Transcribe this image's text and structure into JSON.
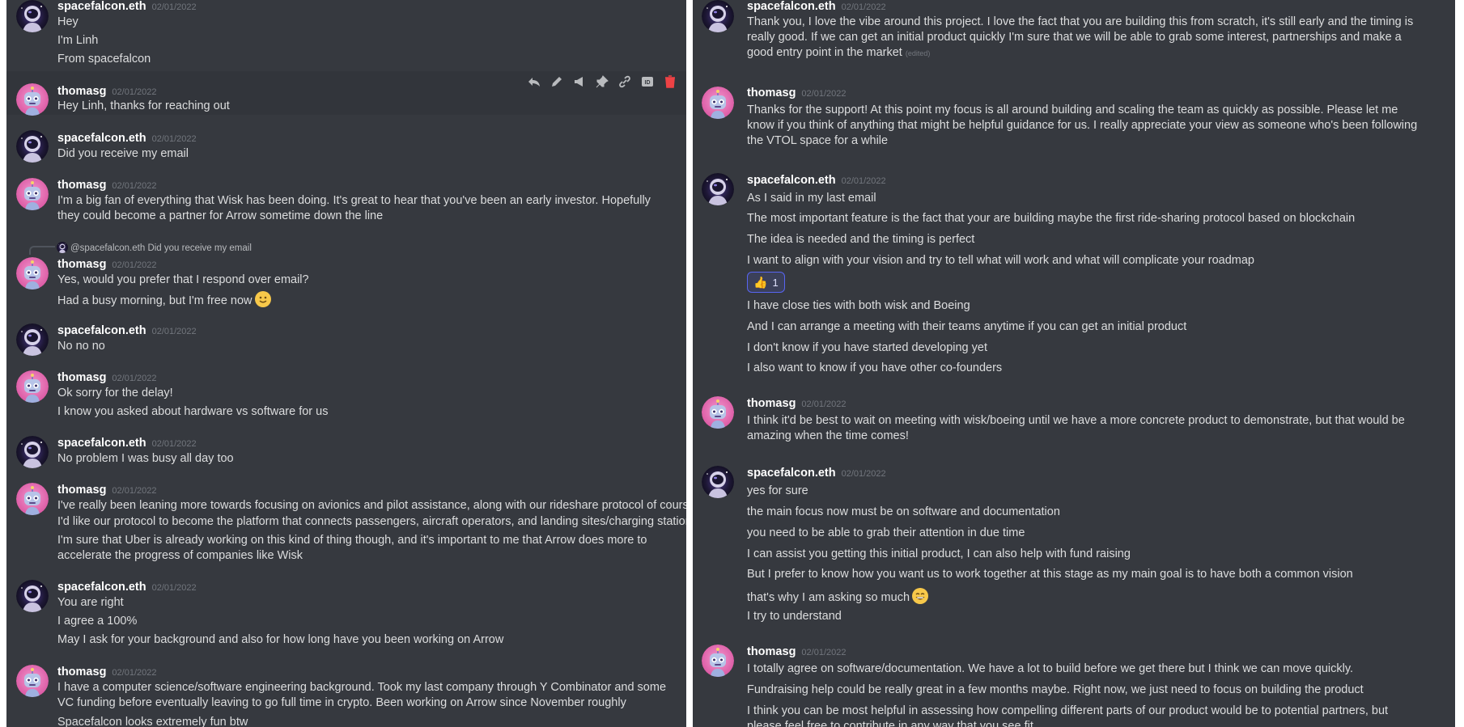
{
  "users": {
    "spacefalcon": {
      "name": "spacefalcon.eth",
      "avatar_icon": "astronaut-avatar-icon"
    },
    "thomas": {
      "name": "thomasg",
      "avatar_icon": "pink-robot-avatar-icon"
    }
  },
  "left": {
    "toolbar_icons": [
      "reply-icon",
      "edit-icon",
      "megaphone-icon",
      "pin-icon",
      "link-icon",
      "id-icon",
      "trash-icon"
    ],
    "messages": [
      {
        "author": "spacefalcon.eth",
        "timestamp": "02/01/2022",
        "lines": [
          "Hey",
          "I'm Linh",
          "From spacefalcon"
        ]
      },
      {
        "author": "thomasg",
        "timestamp": "02/01/2022",
        "lines": [
          "Hey Linh, thanks for reaching out"
        ]
      },
      {
        "author": "spacefalcon.eth",
        "timestamp": "02/01/2022",
        "lines": [
          "Did you receive my email"
        ]
      },
      {
        "author": "thomasg",
        "timestamp": "02/01/2022",
        "lines": [
          "I'm a big fan of everything that Wisk has been doing. It's great to hear that you've been an early investor. Hopefully they could become a partner for Arrow sometime down the line"
        ]
      },
      {
        "author": "thomasg",
        "timestamp": "02/01/2022",
        "reply_to": {
          "mention": "@spacefalcon.eth",
          "text": "Did you receive my email"
        },
        "lines": [
          "Yes, would you prefer that I respond over email?",
          "Had a busy morning, but I'm free now"
        ]
      },
      {
        "author": "spacefalcon.eth",
        "timestamp": "02/01/2022",
        "lines": [
          "No no no"
        ]
      },
      {
        "author": "thomasg",
        "timestamp": "02/01/2022",
        "lines": [
          "Ok sorry for the delay!",
          "I know you asked about hardware vs software for us"
        ]
      },
      {
        "author": "spacefalcon.eth",
        "timestamp": "02/01/2022",
        "lines": [
          "No problem I was busy all day too"
        ]
      },
      {
        "author": "thomasg",
        "timestamp": "02/01/2022",
        "lines": [
          "I've really been leaning more towards focusing on avionics and pilot assistance, along with our rideshare protocol of course.",
          "I'd like our protocol to become the platform that connects passengers, aircraft operators, and landing sites/charging stations",
          "I'm sure that Uber is already working on this kind of thing though, and it's important to me that Arrow does more to accelerate the progress of companies like Wisk"
        ]
      },
      {
        "author": "spacefalcon.eth",
        "timestamp": "02/01/2022",
        "lines": [
          "You are right",
          "I agree a 100%",
          "May I ask for your background and also for how long have you been working on Arrow"
        ]
      },
      {
        "author": "thomasg",
        "timestamp": "02/01/2022",
        "lines": [
          "I have a computer science/software engineering background. Took my last company through Y Combinator and some VC funding before eventually leaving to go full time in crypto. Been working on Arrow since November roughly",
          "Spacefalcon looks extremely fun btw"
        ]
      }
    ]
  },
  "right": {
    "messages": [
      {
        "author": "spacefalcon.eth",
        "timestamp": "02/01/2022",
        "edited_label": "(edited)",
        "lines": [
          "Thank you, I love the vibe around this project. I love the fact that you are building this from scratch, it's still early and the timing is really good. If we can get an initial product quickly I'm sure that we will be able to grab some interest, partnerships and make a good entry point in the market"
        ]
      },
      {
        "author": "thomasg",
        "timestamp": "02/01/2022",
        "lines": [
          "Thanks for the support! At this point my focus is all around building and scaling the team as quickly as possible. Please let me know if you think of anything that might be helpful guidance for us. I really appreciate your view as someone who's been following the VTOL space for a while"
        ]
      },
      {
        "author": "spacefalcon.eth",
        "timestamp": "02/01/2022",
        "reaction": {
          "emoji": "👍",
          "count": "1"
        },
        "lines": [
          "As I said in my last email",
          "The most important feature is the fact that your are building maybe the first ride-sharing protocol based on blockchain",
          "The idea is needed and the timing is perfect",
          "I want to align with your vision and try to tell what will work and what will complicate your roadmap",
          "I have close ties with both wisk and Boeing",
          "And I can arrange a meeting with their teams anytime if you can get an initial product",
          "I don't know if you have started developing yet",
          "I also want to know if you have other co-founders"
        ]
      },
      {
        "author": "thomasg",
        "timestamp": "02/01/2022",
        "lines": [
          "I think it'd be best to wait on meeting with wisk/boeing until we have a more concrete product to demonstrate, but that would be amazing when the time comes!"
        ]
      },
      {
        "author": "spacefalcon.eth",
        "timestamp": "02/01/2022",
        "lines": [
          "yes for sure",
          "the main focus now must be on software and documentation",
          "you need to be able to grab their attention in due time",
          "I can assist you getting this initial product, I can also help with fund raising",
          "But I prefer to know how you want us to work together at this stage as my main goal is to have both a common vision",
          "that's why I am asking so much",
          "I try to understand"
        ]
      },
      {
        "author": "thomasg",
        "timestamp": "02/01/2022",
        "lines": [
          "I totally agree on software/documentation. We have a lot to build before we get there but I think we can move quickly.",
          "Fundraising help could be really great in a few months maybe. Right now, we just need to focus on building the product",
          "I think you can be most helpful in assessing how compelling different parts of our product would be to potential partners, but please feel free to contribute in any way that you see fit"
        ]
      }
    ]
  }
}
